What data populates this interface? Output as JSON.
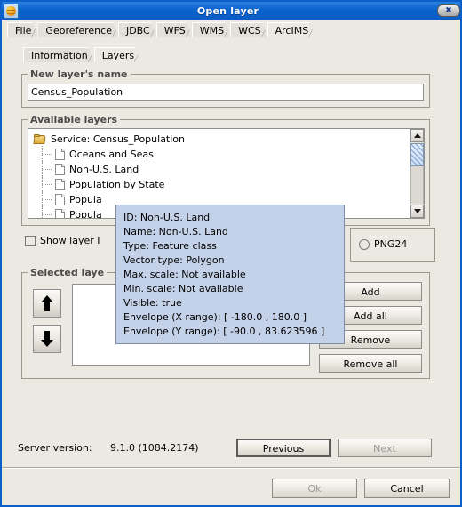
{
  "window": {
    "title": "Open layer",
    "icon": "globe-icon",
    "close_label": "✖",
    "accent": "#0a62cd",
    "panel_bg": "#ece9e2"
  },
  "main_tabs": [
    {
      "label": "File",
      "active": false
    },
    {
      "label": "Georeference",
      "active": false
    },
    {
      "label": "JDBC",
      "active": false
    },
    {
      "label": "WFS",
      "active": false
    },
    {
      "label": "WMS",
      "active": false
    },
    {
      "label": "WCS",
      "active": false
    },
    {
      "label": "ArcIMS",
      "active": true
    }
  ],
  "sub_tabs": [
    {
      "label": "Information",
      "active": false
    },
    {
      "label": "Layers",
      "active": true
    }
  ],
  "layer_name": {
    "group_title": "New layer's name",
    "value": "Census_Population",
    "placeholder": ""
  },
  "available_layers": {
    "group_title": "Available layers",
    "nodes": [
      {
        "label": "Service: Census_Population",
        "icon": "folder-open-icon",
        "level": 0
      },
      {
        "label": "Oceans and Seas",
        "icon": "document-icon",
        "level": 1
      },
      {
        "label": "Non-U.S. Land",
        "icon": "document-icon",
        "level": 1
      },
      {
        "label": "Population by State",
        "icon": "document-icon",
        "level": 1
      },
      {
        "label": "Popula",
        "icon": "document-icon",
        "level": 1
      },
      {
        "label": "Popula",
        "icon": "document-icon",
        "level": 1
      },
      {
        "label": "",
        "icon": "document-icon",
        "level": 1
      }
    ],
    "scrollbar": {
      "up_icon": "scroll-up-icon",
      "down_icon": "scroll-down-icon"
    }
  },
  "tooltip": {
    "lines": [
      "ID: Non-U.S. Land",
      "Name: Non-U.S. Land",
      "Type: Feature class",
      "Vector type: Polygon",
      "Max. scale: Not available",
      "Min. scale: Not available",
      "Visible: true",
      "Envelope (X range): [ -180.0 , 180.0 ]",
      "Envelope (Y range): [ -90.0 , 83.623596 ]"
    ],
    "bg": "#c3d2e8"
  },
  "show_layer_id": {
    "label": "Show layer I",
    "checked": false
  },
  "image_format": {
    "option_label": "PNG24",
    "selected": false
  },
  "selected_layers": {
    "group_title": "Selected laye",
    "move_up_icon": "arrow-up-icon",
    "move_down_icon": "arrow-down-icon",
    "items": [],
    "buttons": [
      {
        "label": "Add",
        "disabled": false
      },
      {
        "label": "Add all",
        "disabled": false
      },
      {
        "label": "Remove",
        "disabled": false
      },
      {
        "label": "Remove all",
        "disabled": false
      }
    ]
  },
  "server": {
    "label": "Server version:",
    "value": "9.1.0 (1084.2174)",
    "previous_label": "Previous",
    "previous_disabled": false,
    "next_label": "Next",
    "next_disabled": true
  },
  "footer": {
    "ok_label": "Ok",
    "ok_disabled": true,
    "cancel_label": "Cancel",
    "cancel_disabled": false
  }
}
